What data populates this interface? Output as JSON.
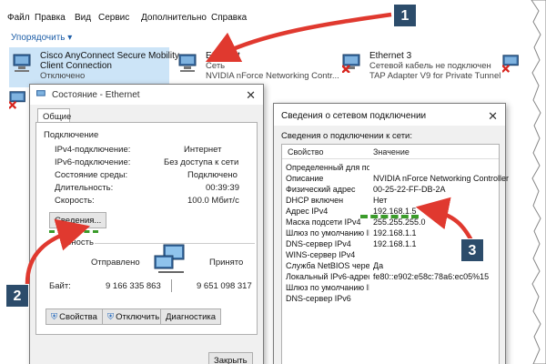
{
  "menubar": {
    "items": [
      "Файл",
      "Правка",
      "Вид",
      "Сервис",
      "Дополнительно",
      "Справка"
    ]
  },
  "toolbar": {
    "organize_label": "Упорядочить ▾"
  },
  "adapters": [
    {
      "name": "Cisco AnyConnect Secure Mobility",
      "name2": "Client Connection",
      "status": "Отключено",
      "device": ""
    },
    {
      "name": "Ethernet",
      "name2": "",
      "status": "Сеть",
      "device": "NVIDIA nForce Networking Contr..."
    },
    {
      "name": "Ethernet 3",
      "name2": "",
      "status": "Сетевой кабель не подключен",
      "device": "TAP Adapter V9 for Private Tunnel"
    }
  ],
  "status_window": {
    "title": "Состояние - Ethernet",
    "tab": "Общие",
    "section_connection": "Подключение",
    "rows": [
      {
        "label": "IPv4-подключение:",
        "value": "Интернет"
      },
      {
        "label": "IPv6-подключение:",
        "value": "Без доступа к сети"
      },
      {
        "label": "Состояние среды:",
        "value": "Подключено"
      },
      {
        "label": "Длительность:",
        "value": "00:39:39"
      },
      {
        "label": "Скорость:",
        "value": "100.0 Мбит/с"
      }
    ],
    "details_button": "Сведения...",
    "section_activity": "ивность",
    "sent_label": "Отправлено",
    "received_label": "Принято",
    "bytes_label": "Байт:",
    "bytes_sent": "9 166 335 863",
    "bytes_received": "9 651 098 317",
    "btn_properties": "Свойства",
    "btn_disable": "Отключить",
    "btn_diagnostics": "Диагностика",
    "btn_close": "Закрыть"
  },
  "details_window": {
    "title": "Сведения о сетевом подключении",
    "subtitle": "Сведения о подключении к сети:",
    "col_property": "Свойство",
    "col_value": "Значение",
    "rows": [
      {
        "k": "Определенный для по...",
        "v": ""
      },
      {
        "k": "Описание",
        "v": "NVIDIA nForce Networking Controller"
      },
      {
        "k": "Физический адрес",
        "v": "00-25-22-FF-DB-2A"
      },
      {
        "k": "DHCP включен",
        "v": "Нет"
      },
      {
        "k": "Адрес IPv4",
        "v": "192.168.1.5"
      },
      {
        "k": "Маска подсети IPv4",
        "v": "255.255.255.0"
      },
      {
        "k": "Шлюз по умолчанию IP...",
        "v": "192.168.1.1"
      },
      {
        "k": "DNS-сервер IPv4",
        "v": "192.168.1.1"
      },
      {
        "k": "WINS-сервер IPv4",
        "v": ""
      },
      {
        "k": "Служба NetBIOS через...",
        "v": "Да"
      },
      {
        "k": "Локальный IPv6-адрес...",
        "v": "fe80::e902:e58c:78a6:ec05%15"
      },
      {
        "k": "Шлюз по умолчанию IP...",
        "v": ""
      },
      {
        "k": "DNS-сервер IPv6",
        "v": ""
      }
    ]
  },
  "callouts": [
    "1",
    "2",
    "3"
  ],
  "colors": {
    "accent_arrow": "#e0392f",
    "highlight_green": "#3a9b2a",
    "badge_bg": "#2c4c6b",
    "selection": "#cce4f7"
  }
}
